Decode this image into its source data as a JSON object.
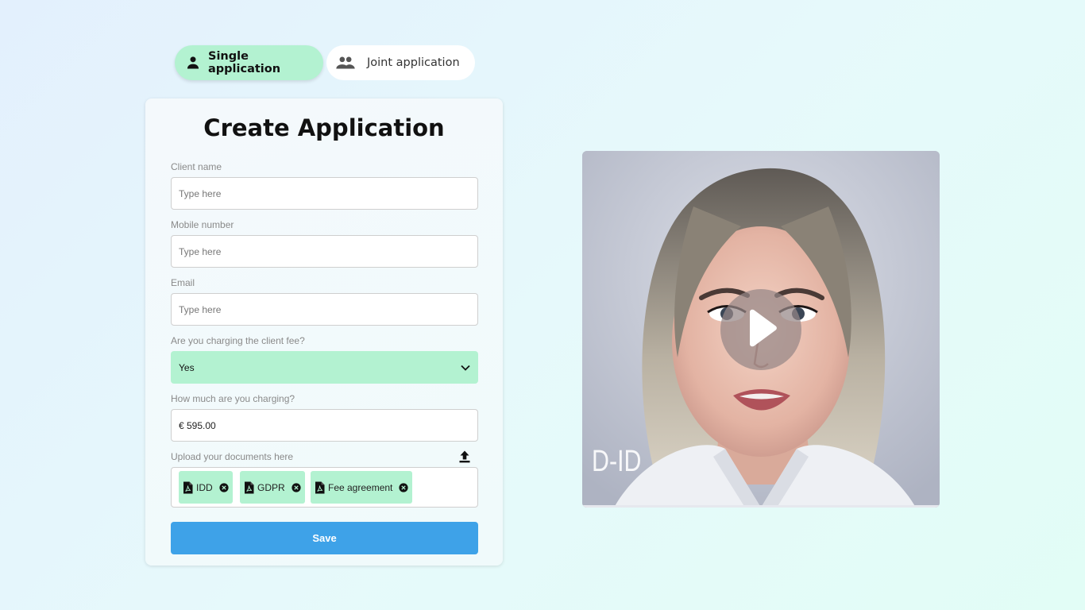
{
  "tabs": [
    {
      "label": "Single application",
      "icon": "person-icon",
      "active": true
    },
    {
      "label": "Joint application",
      "icon": "people-icon",
      "active": false
    }
  ],
  "form": {
    "title": "Create Application",
    "fields": {
      "client_name": {
        "label": "Client name",
        "placeholder": "Type here",
        "value": ""
      },
      "mobile_number": {
        "label": "Mobile number",
        "placeholder": "Type here",
        "value": ""
      },
      "email": {
        "label": "Email",
        "placeholder": "Type here",
        "value": ""
      },
      "charging_fee": {
        "label": "Are you charging the client fee?",
        "value": "Yes"
      },
      "fee_amount": {
        "label": "How much are you charging?",
        "value": "€ 595.00"
      }
    },
    "upload": {
      "label": "Upload your documents here",
      "icon": "upload-icon",
      "documents": [
        {
          "label": "IDD",
          "icon": "pdf-icon"
        },
        {
          "label": "GDPR",
          "icon": "pdf-icon"
        },
        {
          "label": "Fee agreement",
          "icon": "pdf-icon"
        }
      ]
    },
    "save_label": "Save"
  },
  "video": {
    "logo": "D-ID",
    "play_icon": "play-icon"
  },
  "colors": {
    "accent_green": "#b3f2d1",
    "save_blue": "#3ea2e8"
  }
}
